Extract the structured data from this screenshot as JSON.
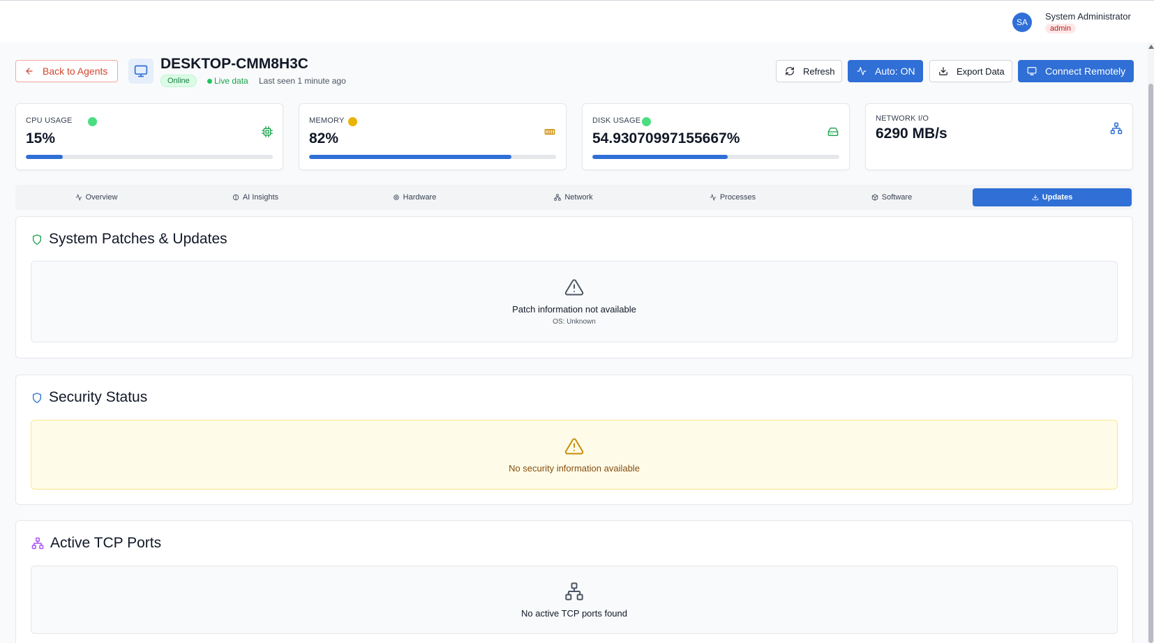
{
  "user": {
    "initials": "SA",
    "name": "System Administrator",
    "role": "admin"
  },
  "header": {
    "back_label": "Back to Agents",
    "device_name": "DESKTOP-CMM8H3C",
    "status": "Online",
    "live_label": "Live data",
    "last_seen": "Last seen 1 minute ago",
    "buttons": {
      "refresh": "Refresh",
      "auto": "Auto: ON",
      "export": "Export Data",
      "connect": "Connect Remotely"
    }
  },
  "metrics": {
    "cpu": {
      "label": "CPU USAGE",
      "value": "15%",
      "percent": 15,
      "dot_color": "#4ade80",
      "icon": "cpu-icon"
    },
    "memory": {
      "label": "MEMORY",
      "value": "82%",
      "percent": 82,
      "dot_color": "#eab308",
      "icon": "memory-icon"
    },
    "disk": {
      "label": "DISK USAGE",
      "value": "54.93070997155667%",
      "percent": 54.93,
      "dot_color": "#4ade80",
      "icon": "hard-drive-icon"
    },
    "network": {
      "label": "NETWORK I/O",
      "value": "6290 MB/s",
      "icon": "network-icon"
    }
  },
  "tabs": [
    {
      "label": "Overview",
      "icon": "activity-icon"
    },
    {
      "label": "AI Insights",
      "icon": "brain-icon"
    },
    {
      "label": "Hardware",
      "icon": "cpu-chip-icon"
    },
    {
      "label": "Network",
      "icon": "network-icon"
    },
    {
      "label": "Processes",
      "icon": "activity-icon"
    },
    {
      "label": "Software",
      "icon": "package-icon"
    },
    {
      "label": "Updates",
      "icon": "download-icon"
    }
  ],
  "active_tab": "Updates",
  "sections": {
    "patches": {
      "title": "System Patches & Updates",
      "message": "Patch information not available",
      "sub": "OS: Unknown"
    },
    "security": {
      "title": "Security Status",
      "message": "No security information available"
    },
    "tcp": {
      "title": "Active TCP Ports",
      "message": "No active TCP ports found"
    }
  },
  "colors": {
    "accent": "#2f6fd6",
    "back_red": "#d0452e",
    "success": "#16a34a",
    "warning": "#ca8a04",
    "purple": "#a855f7"
  }
}
